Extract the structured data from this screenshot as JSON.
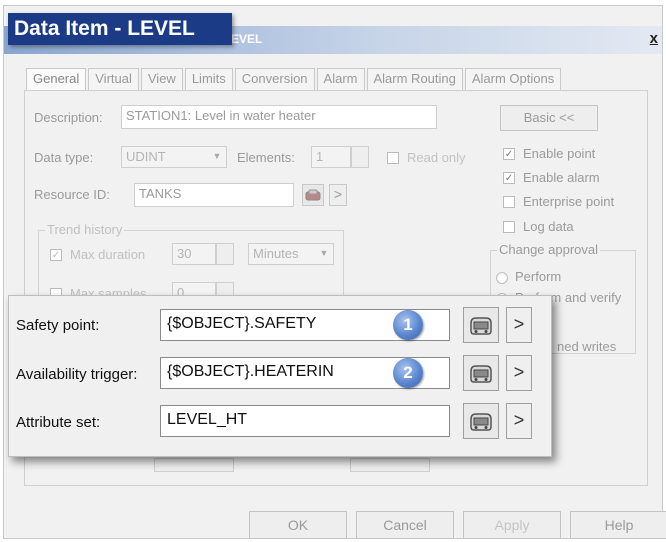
{
  "callout_title": "Data Item - LEVEL",
  "window": {
    "title_fragment": "EVEL",
    "close_label": "x"
  },
  "tabs": [
    "General",
    "Virtual",
    "View",
    "Limits",
    "Conversion",
    "Alarm",
    "Alarm Routing",
    "Alarm Options"
  ],
  "general": {
    "description_label": "Description:",
    "description_value": "STATION1: Level in water heater",
    "basic_button": "Basic <<",
    "data_type_label": "Data type:",
    "data_type_value": "UDINT",
    "elements_label": "Elements:",
    "elements_value": "1",
    "read_only_label": "Read only",
    "resource_id_label": "Resource ID:",
    "resource_id_value": "TANKS",
    "browse_arrow": ">",
    "checkboxes": [
      {
        "label": "Enable point",
        "checked": true
      },
      {
        "label": "Enable alarm",
        "checked": true
      },
      {
        "label": "Enterprise point",
        "checked": false
      },
      {
        "label": "Log data",
        "checked": false
      }
    ],
    "trend_history": {
      "title": "Trend history",
      "max_duration_label": "Max duration",
      "max_duration_checked": true,
      "max_duration_value": "30",
      "duration_unit": "Minutes",
      "max_samples_label": "Max samples",
      "max_samples_value": "0"
    },
    "change_approval": {
      "title": "Change approval",
      "options": [
        "Perform",
        "Perform and verify"
      ],
      "footer_fragment": "ned writes"
    }
  },
  "overlay": {
    "rows": [
      {
        "label": "Safety point:",
        "value": "{$OBJECT}.SAFETY",
        "badge": "1"
      },
      {
        "label": "Availability trigger:",
        "value": "{$OBJECT}.HEATERIN",
        "badge": "2"
      },
      {
        "label": "Attribute set:",
        "value": "LEVEL_HT",
        "badge": ""
      }
    ],
    "arrow_label": ">"
  },
  "buttons": {
    "ok": "OK",
    "cancel": "Cancel",
    "apply": "Apply",
    "help": "Help"
  }
}
